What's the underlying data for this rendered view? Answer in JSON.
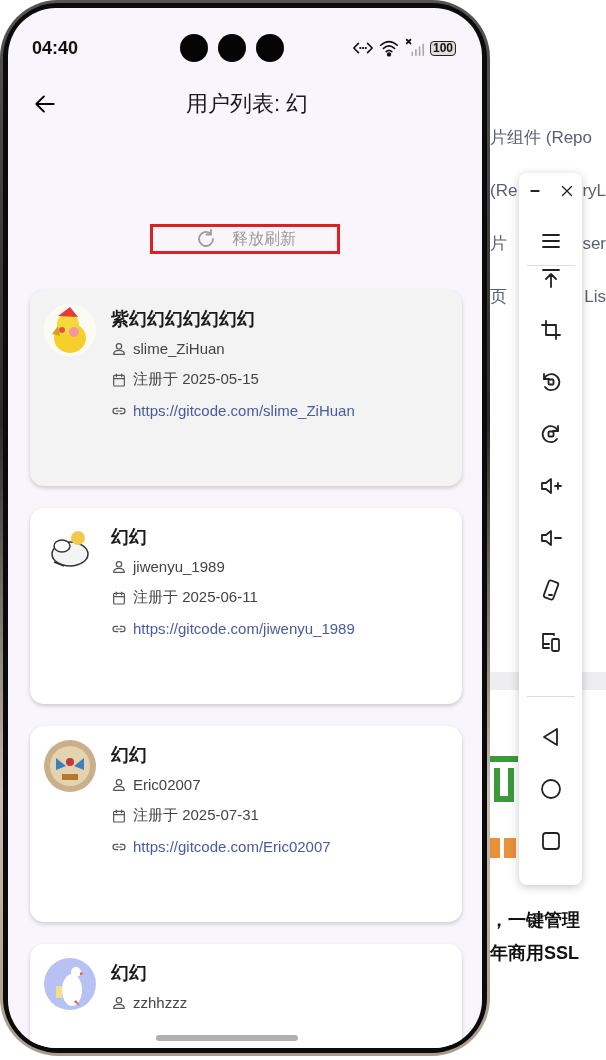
{
  "status_bar": {
    "time": "04:40",
    "battery": "100"
  },
  "app_bar": {
    "title": "用户列表: 幻"
  },
  "refresh": {
    "label": "释放刷新"
  },
  "users": [
    {
      "name": "紫幻幻幻幻幻幻幻",
      "username": "slime_ZiHuan",
      "registered": "注册于 2025-05-15",
      "link": "https://gitcode.com/slime_ZiHuan",
      "pressed": true
    },
    {
      "name": "幻幻",
      "username": "jiwenyu_1989",
      "registered": "注册于 2025-06-11",
      "link": "https://gitcode.com/jiwenyu_1989",
      "pressed": false
    },
    {
      "name": "幻幻",
      "username": "Eric02007",
      "registered": "注册于 2025-07-31",
      "link": "https://gitcode.com/Eric02007",
      "pressed": false
    },
    {
      "name": "幻幻",
      "username": "zzhhzzz",
      "pressed": false
    }
  ],
  "background_page": {
    "rows": [
      {
        "left": "片组件 (Repo"
      },
      {
        "left": "(Re",
        "right": "ryL"
      },
      {
        "left": "片",
        "right": "ser"
      },
      {
        "left": "页",
        "right": "Lis"
      }
    ],
    "lines": [
      "，一键管理",
      "年商用SSL"
    ]
  }
}
